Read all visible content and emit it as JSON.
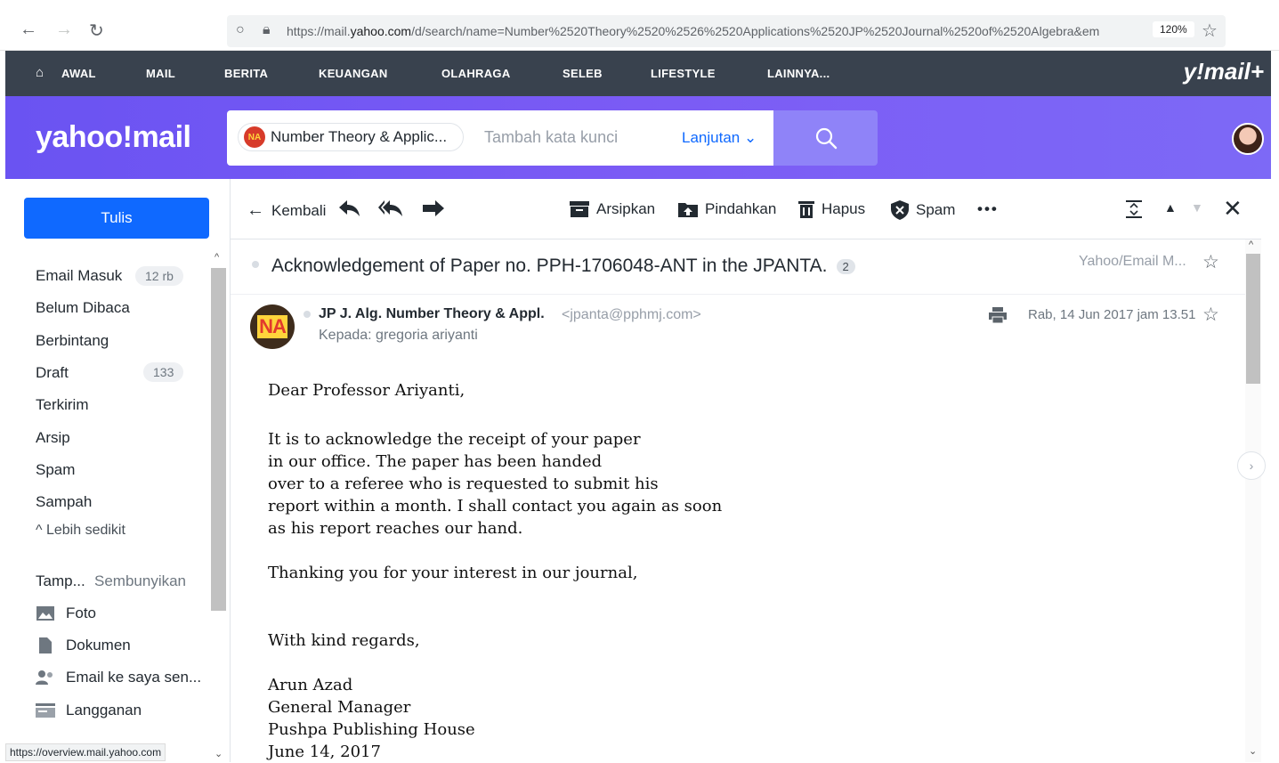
{
  "browser": {
    "url_prefix": "https://mail.",
    "url_domain": "yahoo.com",
    "url_rest": "/d/search/name=Number%2520Theory%2520%2526%2520Applications%2520JP%2520Journal%2520of%2520Algebra&em",
    "zoom": "120%"
  },
  "topnav": {
    "items": [
      "AWAL",
      "MAIL",
      "BERITA",
      "KEUANGAN",
      "OLAHRAGA",
      "SELEB",
      "LIFESTYLE",
      "LAINNYA..."
    ],
    "brand": "y!mail+"
  },
  "header": {
    "logo": "yahoo!mail",
    "search_chip": "Number Theory & Applic...",
    "search_chip_logo": "NA",
    "keyword_placeholder": "Tambah kata kunci",
    "advanced_label": "Lanjutan"
  },
  "sidebar": {
    "compose_label": "Tulis",
    "folders": [
      {
        "label": "Email Masuk",
        "count": "12 rb"
      },
      {
        "label": "Belum Dibaca",
        "count": ""
      },
      {
        "label": "Berbintang",
        "count": ""
      },
      {
        "label": "Draft",
        "count": "133"
      },
      {
        "label": "Terkirim",
        "count": ""
      },
      {
        "label": "Arsip",
        "count": ""
      },
      {
        "label": "Spam",
        "count": ""
      },
      {
        "label": "Sampah",
        "count": ""
      }
    ],
    "less_label": "Lebih sedikit",
    "views_label": "Tamp...",
    "views_hide": "Sembunyikan",
    "views": [
      {
        "label": "Foto",
        "icon": "photo-icon"
      },
      {
        "label": "Dokumen",
        "icon": "document-icon"
      },
      {
        "label": "Email ke saya sen...",
        "icon": "people-icon"
      },
      {
        "label": "Langganan",
        "icon": "subscription-icon"
      }
    ],
    "status_url": "https://overview.mail.yahoo.com"
  },
  "toolbar": {
    "back_label": "Kembali",
    "archive_label": "Arsipkan",
    "move_label": "Pindahkan",
    "delete_label": "Hapus",
    "spam_label": "Spam"
  },
  "message": {
    "subject": "Acknowledgement of Paper no. PPH-1706048-ANT in the JPANTA.",
    "thread_count": "2",
    "folder": "Yahoo/Email M...",
    "sender_name": "JP J. Alg. Number Theory & Appl.",
    "sender_email": "<jpanta@pphmj.com>",
    "recipient": "Kepada: gregoria ariyanti",
    "date": "Rab, 14 Jun 2017 jam 13.51",
    "avatar_text": "NA",
    "body": {
      "greeting": "Dear Professor Ariyanti,",
      "para1": [
        "It is to acknowledge the receipt of your paper",
        "in our office. The paper has been handed",
        "over to a referee who is requested to submit his",
        "report within a month. I shall contact you again as soon",
        "as his report reaches our hand."
      ],
      "thanks": "Thanking you for your interest in our journal,",
      "closing": "With kind regards,",
      "signature": [
        "Arun Azad",
        "General Manager",
        "Pushpa Publishing House",
        "June 14, 2017"
      ]
    }
  },
  "colors": {
    "header_gradient_start": "#6a53f2",
    "nav_bg": "#39424e",
    "compose_blue": "#0f69ff",
    "search_btn": "#8f83f8"
  }
}
